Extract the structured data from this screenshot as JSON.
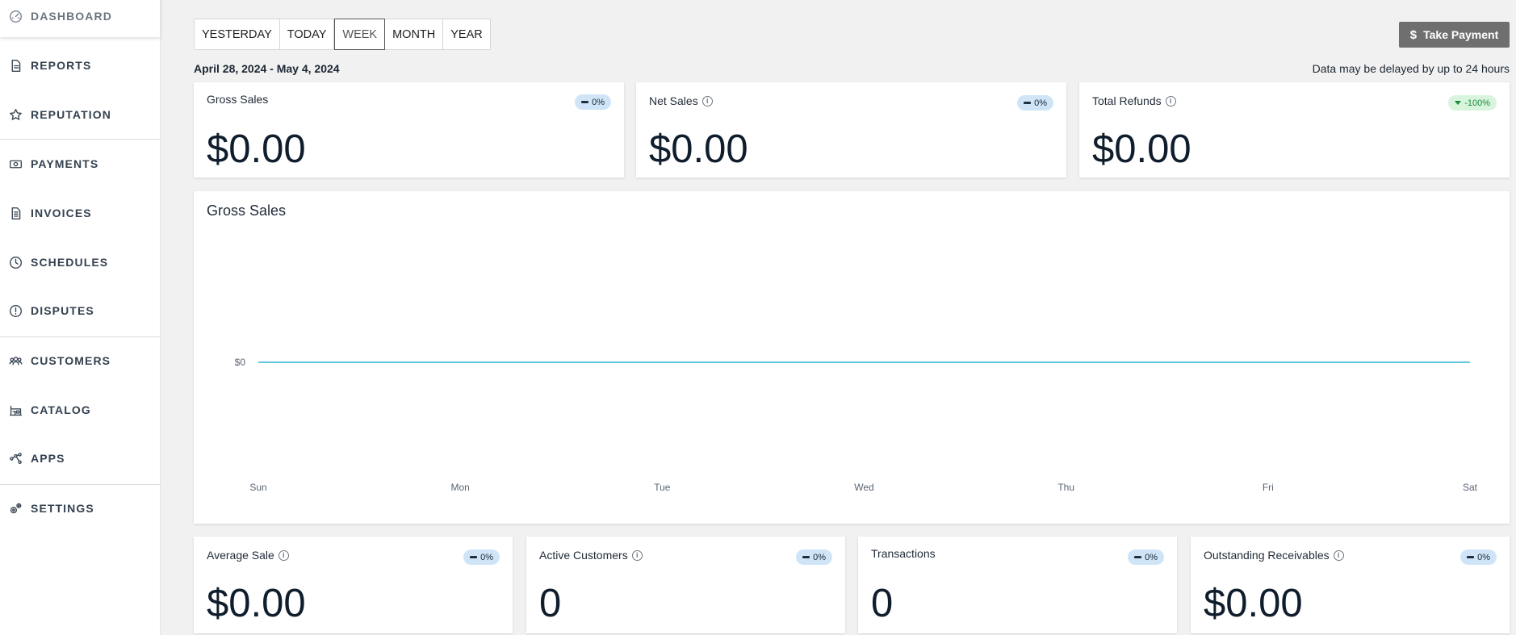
{
  "sidebar": {
    "items": [
      {
        "label": "DASHBOARD",
        "icon": "gauge-icon"
      },
      {
        "label": "REPORTS",
        "icon": "report-icon"
      },
      {
        "label": "REPUTATION",
        "icon": "star-icon"
      },
      {
        "label": "PAYMENTS",
        "icon": "cash-icon"
      },
      {
        "label": "INVOICES",
        "icon": "invoice-icon"
      },
      {
        "label": "SCHEDULES",
        "icon": "clock-icon"
      },
      {
        "label": "DISPUTES",
        "icon": "alert-icon"
      },
      {
        "label": "CUSTOMERS",
        "icon": "users-icon"
      },
      {
        "label": "CATALOG",
        "icon": "catalog-icon"
      },
      {
        "label": "APPS",
        "icon": "apps-icon"
      },
      {
        "label": "SETTINGS",
        "icon": "gears-icon"
      }
    ]
  },
  "range": {
    "options": [
      "YESTERDAY",
      "TODAY",
      "WEEK",
      "MONTH",
      "YEAR"
    ],
    "selected": "WEEK"
  },
  "actions": {
    "take_payment": "Take Payment",
    "take_payment_symbol": "$"
  },
  "header": {
    "date_range": "April 28, 2024 - May 4, 2024",
    "delay_note": "Data may be delayed by up to 24 hours"
  },
  "kpis_top": [
    {
      "label": "Gross Sales",
      "value": "$0.00",
      "change": "0%",
      "trend": "flat",
      "info": false
    },
    {
      "label": "Net Sales",
      "value": "$0.00",
      "change": "0%",
      "trend": "flat",
      "info": true
    },
    {
      "label": "Total Refunds",
      "value": "$0.00",
      "change": "-100%",
      "trend": "down",
      "info": true
    }
  ],
  "kpis_bottom": [
    {
      "label": "Average Sale",
      "value": "$0.00",
      "change": "0%",
      "trend": "flat",
      "info": true
    },
    {
      "label": "Active Customers",
      "value": "0",
      "change": "0%",
      "trend": "flat",
      "info": true
    },
    {
      "label": "Transactions",
      "value": "0",
      "change": "0%",
      "trend": "flat",
      "info": false
    },
    {
      "label": "Outstanding Receivables",
      "value": "$0.00",
      "change": "0%",
      "trend": "flat",
      "info": true
    }
  ],
  "colors": {
    "line": "#2bb5d1",
    "badge_flat": "#cfe5f7",
    "badge_down": "#d8f4dd",
    "button": "#6f6f6f"
  },
  "chart_data": {
    "type": "line",
    "title": "Gross Sales",
    "categories": [
      "Sun",
      "Mon",
      "Tue",
      "Wed",
      "Thu",
      "Fri",
      "Sat"
    ],
    "series": [
      {
        "values": [
          0,
          0,
          0,
          0,
          0,
          0,
          0
        ]
      }
    ],
    "y_tick_labels": [
      "$0"
    ],
    "grid": false
  }
}
